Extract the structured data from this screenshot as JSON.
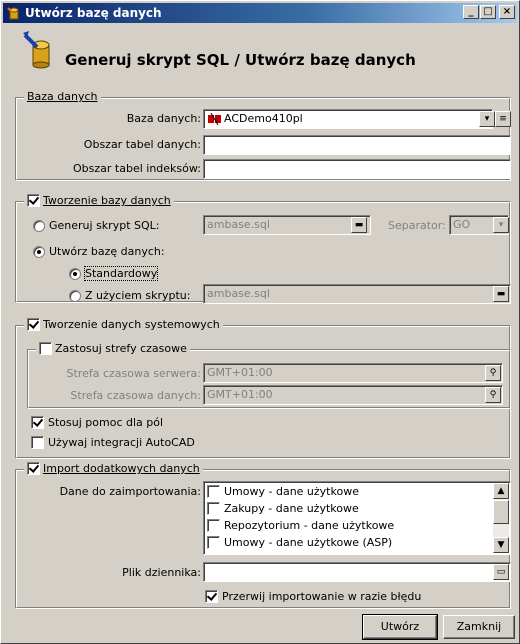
{
  "window": {
    "title": "Utwórz bazę danych",
    "header": "Generuj skrypt SQL / Utwórz bazę danych",
    "controls": [
      "_",
      "□",
      "×"
    ]
  },
  "db_group": {
    "legend": "Baza danych",
    "db_label": "Baza danych:",
    "db_value": "ACDemo410pl",
    "tables_area_label": "Obszar tabel danych:",
    "tables_area_value": "",
    "index_area_label": "Obszar tabel indeksów:",
    "index_area_value": ""
  },
  "create_group": {
    "legend": "Tworzenie bazy danych",
    "checked": true,
    "gen_sql_label": "Generuj skrypt SQL:",
    "gen_sql_file": "ambase.sql",
    "separator_label": "Separator:",
    "separator_value": "GO",
    "create_db_label": "Utwórz bazę danych:",
    "standard_label": "Standardowy",
    "with_script_label": "Z użyciem skryptu:",
    "script_file": "ambase.sql",
    "mode": "create_db",
    "submode": "standard"
  },
  "system_group": {
    "legend": "Tworzenie danych systemowych",
    "checked": true,
    "tz_legend": "Zastosuj strefy czasowe",
    "tz_checked": false,
    "server_tz_label": "Strefa czasowa serwera:",
    "server_tz_value": "GMT+01:00",
    "data_tz_label": "Strefa czasowa danych:",
    "data_tz_value": "GMT+01:00",
    "field_help_label": "Stosuj pomoc dla pól",
    "field_help_checked": true,
    "autocad_label": "Używaj integracji AutoCAD",
    "autocad_checked": false
  },
  "import_group": {
    "legend": "Import dodatkowych danych",
    "checked": true,
    "data_label": "Dane do zaimportowania:",
    "items": [
      {
        "label": "Umowy - dane użytkowe",
        "checked": false
      },
      {
        "label": "Zakupy - dane użytkowe",
        "checked": false
      },
      {
        "label": "Repozytorium - dane użytkowe",
        "checked": false
      },
      {
        "label": "Umowy - dane użytkowe (ASP)",
        "checked": false
      }
    ],
    "log_label": "Plik dziennika:",
    "log_value": "",
    "abort_label": "Przerwij importowanie w razie błędu",
    "abort_checked": true
  },
  "buttons": {
    "create": "Utwórz",
    "close": "Zamknij"
  },
  "colors": {
    "face": "#d4d0c8",
    "title_start": "#0a246a",
    "title_end": "#a6caf0"
  }
}
